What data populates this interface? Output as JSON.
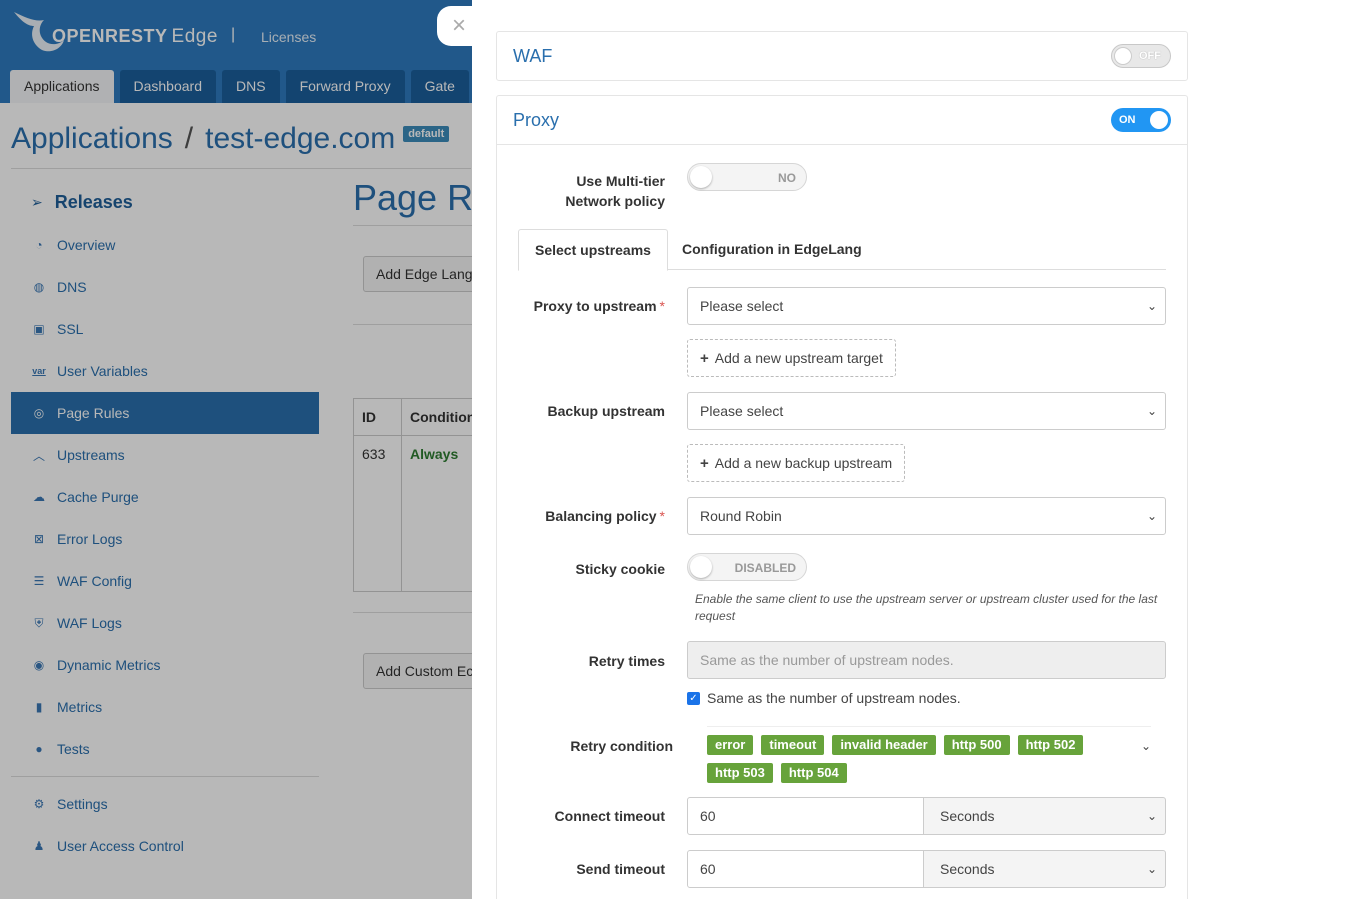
{
  "header": {
    "brand": "OPENRESTY",
    "product": "Edge",
    "separator": "|",
    "licenses": "Licenses",
    "nav_tabs": [
      "Applications",
      "Dashboard",
      "DNS",
      "Forward Proxy",
      "Gate"
    ]
  },
  "breadcrumb": {
    "root": "Applications",
    "slash": "/",
    "app": "test-edge.com",
    "badge": "default"
  },
  "sidebar": {
    "releases": "Releases",
    "items": [
      {
        "label": "Overview",
        "icon": "dashboard-icon"
      },
      {
        "label": "DNS",
        "icon": "globe-icon"
      },
      {
        "label": "SSL",
        "icon": "certificate-icon"
      },
      {
        "label": "User Variables",
        "icon": "var-icon"
      },
      {
        "label": "Page Rules",
        "icon": "rules-icon"
      },
      {
        "label": "Upstreams",
        "icon": "upstream-icon"
      },
      {
        "label": "Cache Purge",
        "icon": "cloud-icon"
      },
      {
        "label": "Error Logs",
        "icon": "error-log-icon"
      },
      {
        "label": "WAF Config",
        "icon": "list-icon"
      },
      {
        "label": "WAF Logs",
        "icon": "waf-log-icon"
      },
      {
        "label": "Dynamic Metrics",
        "icon": "location-icon"
      },
      {
        "label": "Metrics",
        "icon": "bar-chart-icon"
      },
      {
        "label": "Tests",
        "icon": "test-icon"
      }
    ],
    "bottom_items": [
      {
        "label": "Settings",
        "icon": "gear-icon"
      },
      {
        "label": "User Access Control",
        "icon": "user-gear-icon"
      }
    ]
  },
  "background": {
    "page_title": "Page R",
    "add_edge_button": "Add Edge Lang",
    "table": {
      "col_id": "ID",
      "col_condition": "Condition",
      "row_id": "633",
      "row_condition": "Always"
    },
    "add_custom_button": "Add Custom Ec"
  },
  "drawer": {
    "close_icon": "×",
    "waf": {
      "title": "WAF",
      "switch": "OFF"
    },
    "proxy": {
      "title": "Proxy",
      "switch": "ON",
      "multi_tier_label_1": "Use Multi-tier",
      "multi_tier_label_2": "Network policy",
      "multi_tier_value": "NO",
      "tabs": [
        "Select upstreams",
        "Configuration in EdgeLang"
      ],
      "proxy_upstream_label": "Proxy to upstream",
      "proxy_upstream_value": "Please select",
      "add_upstream_button": "Add a new upstream target",
      "backup_upstream_label": "Backup upstream",
      "backup_upstream_value": "Please select",
      "add_backup_button": "Add a new backup upstream",
      "balancing_label": "Balancing policy",
      "balancing_value": "Round Robin",
      "sticky_label": "Sticky cookie",
      "sticky_value": "DISABLED",
      "sticky_help": "Enable the same client to use the upstream server or upstream cluster used for the last request",
      "retry_times_label": "Retry times",
      "retry_times_placeholder": "Same as the number of upstream nodes.",
      "retry_checkbox_label": "Same as the number of upstream nodes.",
      "retry_condition_label": "Retry condition",
      "retry_tags": [
        "error",
        "timeout",
        "invalid header",
        "http 500",
        "http 502",
        "http 503",
        "http 504"
      ],
      "connect_timeout_label": "Connect timeout",
      "connect_timeout_value": "60",
      "connect_timeout_unit": "Seconds",
      "send_timeout_label": "Send timeout",
      "send_timeout_value": "60",
      "send_timeout_unit": "Seconds"
    }
  },
  "colors": {
    "primary": "#2a6fad",
    "topbar": "#2e7bbf",
    "switch_on": "#2196f3",
    "tag": "#67a33b"
  }
}
